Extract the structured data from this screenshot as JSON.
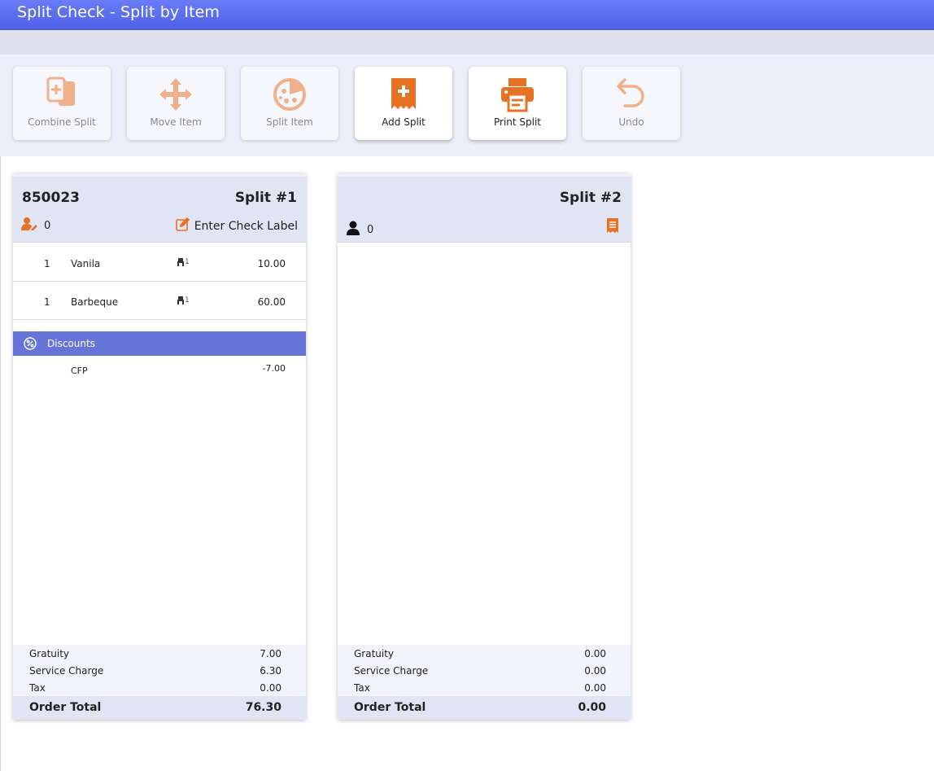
{
  "window": {
    "title": "Split Check - Split by Item"
  },
  "colors": {
    "accent": "#e87224",
    "header": "#5a6cf0",
    "discount_bar": "#6574d6"
  },
  "toolbar": {
    "buttons": [
      {
        "label": "Combine Split",
        "icon": "combine-split-icon",
        "enabled": false
      },
      {
        "label": "Move Item",
        "icon": "move-arrows-icon",
        "enabled": false
      },
      {
        "label": "Split Item",
        "icon": "pizza-icon",
        "enabled": false
      },
      {
        "label": "Add Split",
        "icon": "add-receipt-icon",
        "enabled": true
      },
      {
        "label": "Print Split",
        "icon": "printer-icon",
        "enabled": true
      },
      {
        "label": "Undo",
        "icon": "undo-icon",
        "enabled": false
      }
    ]
  },
  "splits": [
    {
      "check_number": "850023",
      "split_label": "Split #1",
      "guest_count": "0",
      "check_label_placeholder": "Enter Check Label",
      "items": [
        {
          "qty": "1",
          "name": "Vanila",
          "seat": "1",
          "price": "10.00"
        },
        {
          "qty": "1",
          "name": "Barbeque",
          "seat": "1",
          "price": "60.00"
        }
      ],
      "discounts_header": "Discounts",
      "discounts": [
        {
          "name": "CFP",
          "amount": "-7.00"
        }
      ],
      "totals": {
        "gratuity_label": "Gratuity",
        "gratuity": "7.00",
        "service_label": "Service Charge",
        "service": "6.30",
        "tax_label": "Tax",
        "tax": "0.00",
        "order_total_label": "Order Total",
        "order_total": "76.30"
      }
    },
    {
      "split_label": "Split #2",
      "guest_count": "0",
      "totals": {
        "gratuity_label": "Gratuity",
        "gratuity": "0.00",
        "service_label": "Service Charge",
        "service": "0.00",
        "tax_label": "Tax",
        "tax": "0.00",
        "order_total_label": "Order Total",
        "order_total": "0.00"
      }
    }
  ]
}
